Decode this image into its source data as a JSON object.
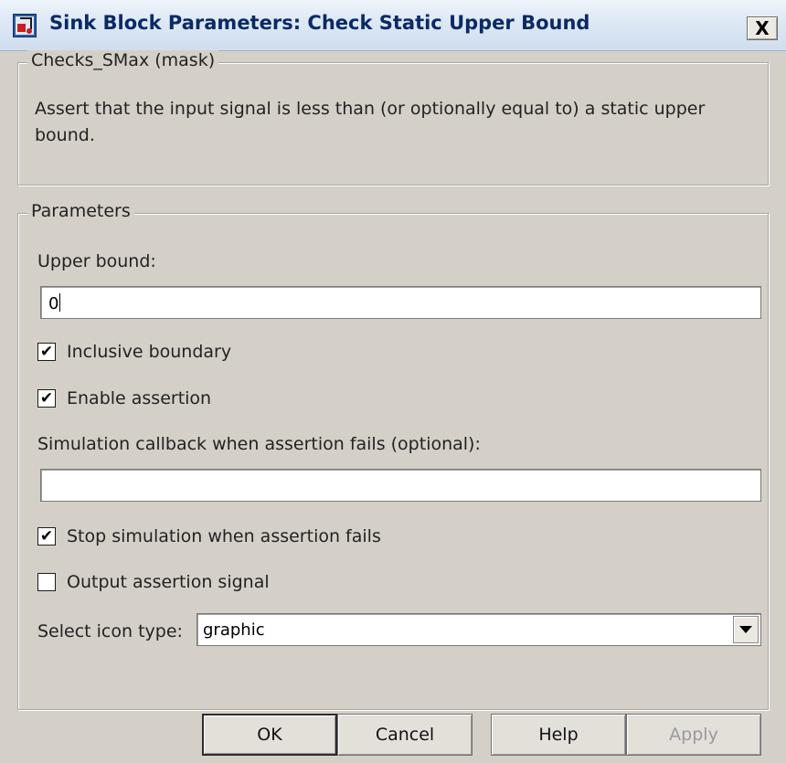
{
  "window": {
    "title": "Sink Block Parameters: Check Static Upper Bound",
    "close_label": "X"
  },
  "mask": {
    "group_title": "Checks_SMax (mask)",
    "description": "Assert that the input signal is less than (or optionally equal to) a static upper bound."
  },
  "parameters": {
    "group_title": "Parameters",
    "upper_bound_label": "Upper bound:",
    "upper_bound_value": "0",
    "inclusive_boundary": {
      "label": "Inclusive boundary",
      "checked": true
    },
    "enable_assertion": {
      "label": "Enable assertion",
      "checked": true
    },
    "callback_label": "Simulation callback when assertion fails (optional):",
    "callback_value": "",
    "stop_simulation": {
      "label": "Stop simulation when assertion fails",
      "checked": true
    },
    "output_assertion": {
      "label": "Output assertion signal",
      "checked": false
    },
    "icon_type_label": "Select icon type:",
    "icon_type_value": "graphic"
  },
  "buttons": {
    "ok": "OK",
    "cancel": "Cancel",
    "help": "Help",
    "apply": "Apply",
    "apply_enabled": false
  },
  "colors": {
    "dialog_bg": "#d4d0c8",
    "title_text": "#0a2a66"
  }
}
